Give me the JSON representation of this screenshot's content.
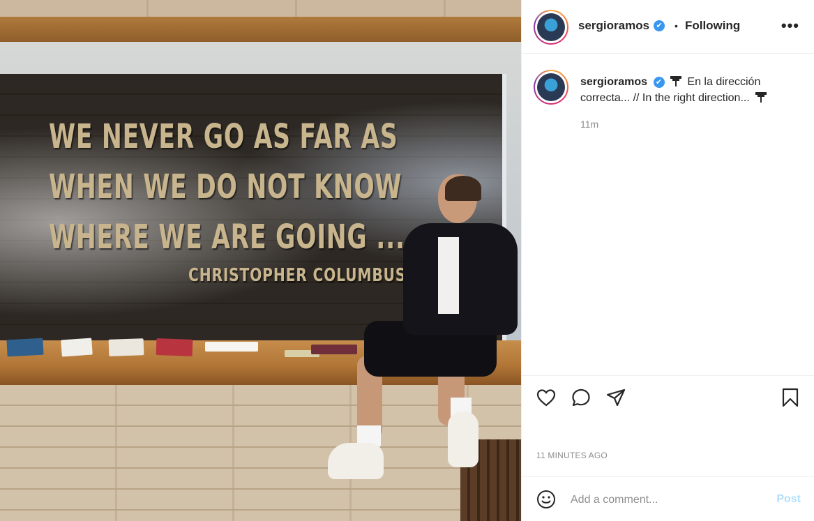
{
  "post": {
    "photo_quote": {
      "lines": [
        "WE NEVER GO AS FAR AS",
        "WHEN WE DO NOT KNOW",
        "WHERE WE ARE GOING ..."
      ],
      "author": "CHRISTOPHER  COLUMBUS"
    },
    "header": {
      "username": "sergioramos",
      "verified_mark": "✔",
      "separator": "•",
      "follow_status": "Following",
      "more_label": "•••"
    },
    "caption": {
      "username": "sergioramos",
      "text_part1": "En la dirección correcta... // In the right direction...",
      "time": "11m"
    },
    "actions": {
      "like_icon": "heart-icon",
      "comment_icon": "speech-bubble-icon",
      "share_icon": "paper-plane-icon",
      "save_icon": "bookmark-icon"
    },
    "timestamp": "11 MINUTES AGO",
    "comment_box": {
      "placeholder": "Add a comment...",
      "post_label": "Post"
    },
    "colors": {
      "verified": "#3897f0",
      "post_button_disabled": "#b2dffc",
      "secondary_text": "#8e8e8e"
    }
  }
}
